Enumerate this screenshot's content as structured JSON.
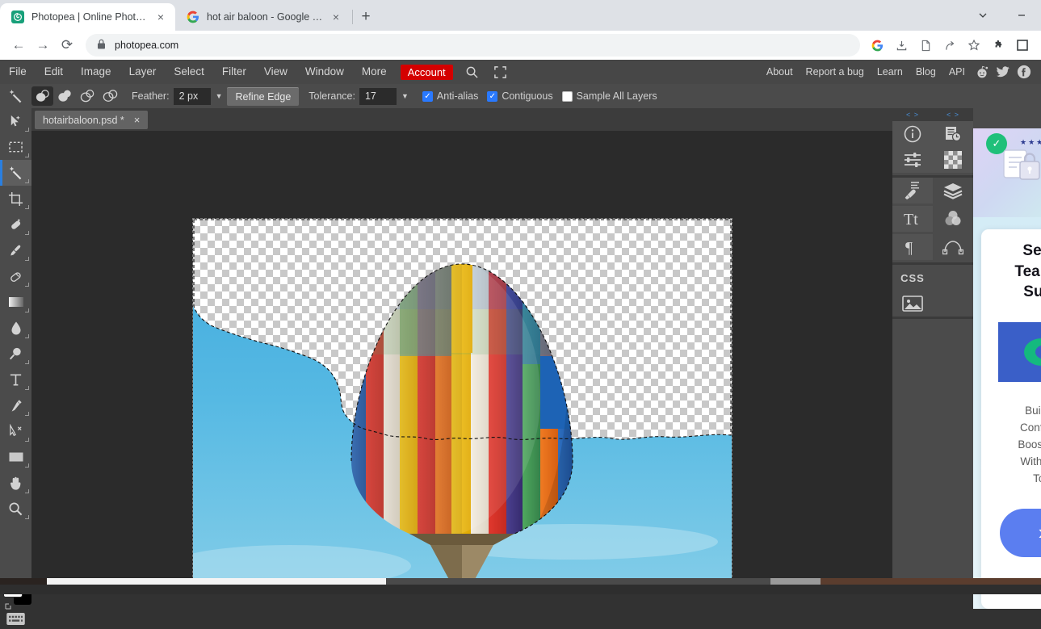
{
  "browser": {
    "tabs": [
      {
        "title": "Photopea | Online Photo Editor",
        "favicon": "photopea-icon",
        "close": "×",
        "active": true
      },
      {
        "title": "hot air baloon - Google Search",
        "favicon": "google-icon",
        "close": "×",
        "active": false
      }
    ],
    "newtab_label": "+",
    "window_controls": {
      "chevron": "⌵",
      "minimize": "—"
    },
    "nav": {
      "back": "←",
      "forward": "→",
      "reload": "⟳"
    },
    "omnibox": {
      "lock_icon": "lock-icon",
      "url": "photopea.com"
    },
    "toolbar_icons": [
      "google-icon",
      "install-icon",
      "document-icon",
      "share-icon",
      "bookmark-star-icon",
      "extensions-icon",
      "profile-icon"
    ]
  },
  "app": {
    "menu": [
      "File",
      "Edit",
      "Image",
      "Layer",
      "Select",
      "Filter",
      "View",
      "Window",
      "More"
    ],
    "account_label": "Account",
    "menu_icons": [
      "search-icon",
      "fullscreen-icon"
    ],
    "links": [
      "About",
      "Report a bug",
      "Learn",
      "Blog",
      "API"
    ],
    "social": [
      "reddit-icon",
      "twitter-icon",
      "facebook-icon"
    ]
  },
  "options": {
    "tool_icon": "magic-wand-icon",
    "selection_modes": [
      {
        "name": "new-selection",
        "active": true
      },
      {
        "name": "add-to-selection",
        "active": false
      },
      {
        "name": "subtract-from-selection",
        "active": false
      },
      {
        "name": "intersect-selection",
        "active": false
      }
    ],
    "feather_label": "Feather:",
    "feather_value": "2 px",
    "refine_edge_label": "Refine Edge",
    "tolerance_label": "Tolerance:",
    "tolerance_value": "17",
    "checkboxes": [
      {
        "label": "Anti-alias",
        "checked": true
      },
      {
        "label": "Contiguous",
        "checked": true
      },
      {
        "label": "Sample All Layers",
        "checked": false
      }
    ]
  },
  "tools": [
    {
      "name": "move-tool",
      "active": false
    },
    {
      "name": "rectangular-marquee-tool",
      "active": false
    },
    {
      "name": "magic-wand-tool",
      "active": true
    },
    {
      "name": "crop-tool",
      "active": false
    },
    {
      "name": "spot-healing-brush-tool",
      "active": false
    },
    {
      "name": "brush-tool",
      "active": false
    },
    {
      "name": "eraser-tool",
      "active": false
    },
    {
      "name": "gradient-tool",
      "active": false
    },
    {
      "name": "blur-tool",
      "active": false
    },
    {
      "name": "dodge-tool",
      "active": false
    },
    {
      "name": "type-tool",
      "active": false
    },
    {
      "name": "pen-tool",
      "active": false
    },
    {
      "name": "path-selection-tool",
      "active": false
    },
    {
      "name": "shape-tool",
      "active": false
    },
    {
      "name": "hand-tool",
      "active": false
    },
    {
      "name": "zoom-tool",
      "active": false
    }
  ],
  "swatches": {
    "foreground": "#ffffff",
    "background": "#000000"
  },
  "keyboard_icon": "keyboard-icon",
  "document": {
    "tab_label": "hotairbaloon.psd *",
    "close": "×",
    "content_description": "hot air balloon with multicolored vertical gores over blue sky, sky region removed showing transparency checkerboard with active marching-ants selection"
  },
  "panels": {
    "rail_headers": [
      "< >",
      "< >"
    ],
    "icons": [
      "info-icon",
      "history-icon",
      "adjustments-icon",
      "pattern-icon",
      "brush-settings-icon",
      "layers-icon",
      "character-icon",
      "color-wheel-icon",
      "paragraph-icon",
      "paths-icon",
      "css-icon",
      "image-icon"
    ],
    "css_label": "CSS"
  },
  "ad": {
    "title_lines": [
      "Set Y",
      "Team U",
      "Succ"
    ],
    "body_lines": [
      "Build T",
      "Confiden",
      "Boost Pro",
      "With Gra",
      "Tod"
    ],
    "cta_icon": "›",
    "logo": "brand-logo",
    "stars": "★★★",
    "badge_icon": "✓"
  }
}
